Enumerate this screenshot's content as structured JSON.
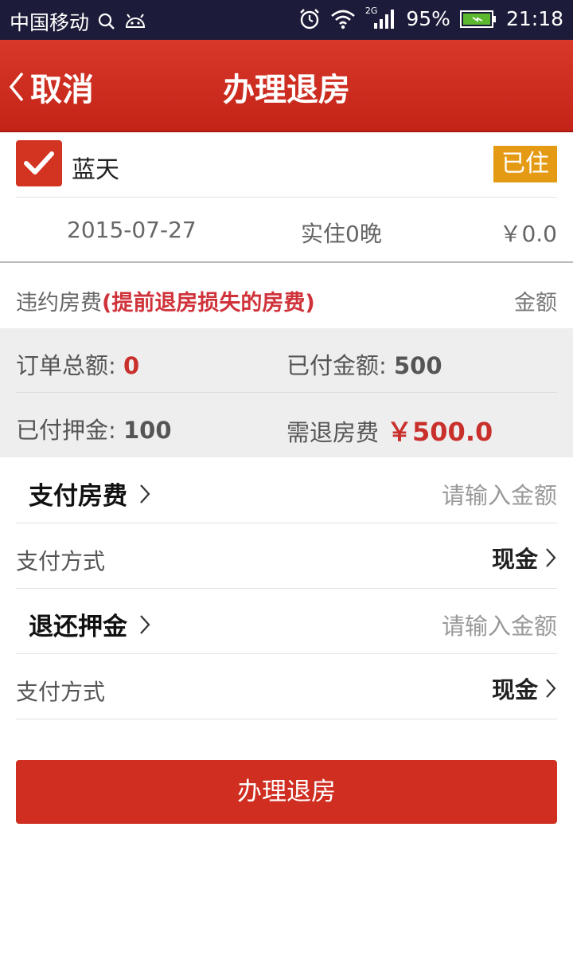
{
  "status_bar": {
    "carrier": "中国移动",
    "network": "2G",
    "battery": "95%",
    "time": "21:18"
  },
  "header": {
    "back_label": "取消",
    "title": "办理退房"
  },
  "guest": {
    "name": "蓝天",
    "checked": true,
    "status": "已住"
  },
  "stay": {
    "date": "2015-07-27",
    "nights": "实住0晚",
    "price": "￥0.0"
  },
  "breach_fee": {
    "label": "违约房费",
    "note": "(提前退房损失的房费)",
    "amount_label": "金额"
  },
  "summary": {
    "order_total_label": "订单总额:",
    "order_total_value": "0",
    "paid_amount_label": "已付金额:",
    "paid_amount_value": "500",
    "deposit_paid_label": "已付押金:",
    "deposit_paid_value": "100",
    "refund_label": "需退房费",
    "refund_value": "￥500.0"
  },
  "form": {
    "pay_room_label": "支付房费",
    "pay_room_placeholder": "请输入金额",
    "pay_method_label_1": "支付方式",
    "pay_method_value_1": "现金",
    "refund_deposit_label": "退还押金",
    "refund_deposit_placeholder": "请输入金额",
    "pay_method_label_2": "支付方式",
    "pay_method_value_2": "现金"
  },
  "submit_label": "办理退房",
  "colors": {
    "header_red": "#d33321",
    "badge_orange": "#e59a13",
    "accent_red": "#c9302c",
    "summary_bg": "#eeeeef"
  }
}
